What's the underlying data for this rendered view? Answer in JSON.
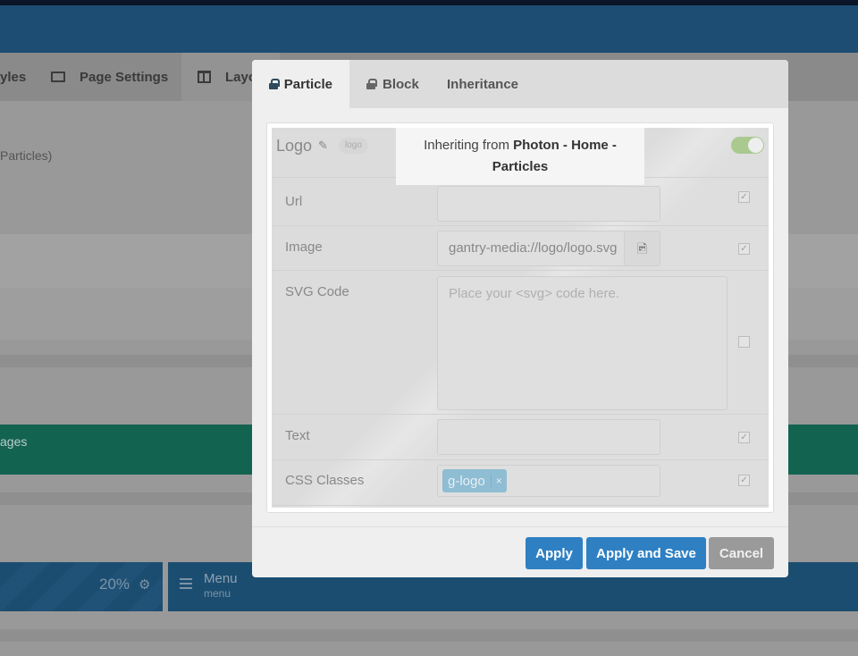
{
  "background": {
    "tabs": [
      {
        "label": "yles"
      },
      {
        "label": "Page Settings",
        "icon": "page-settings-icon"
      },
      {
        "label": "Layo",
        "icon": "layout-icon"
      }
    ],
    "section_label": "Particles)",
    "green_block_label": "ages",
    "block_percent": "20%",
    "menu": {
      "title": "Menu",
      "subtitle": "menu"
    }
  },
  "modal": {
    "tabs": [
      {
        "label": "Particle",
        "icon": "lock-icon",
        "active": true
      },
      {
        "label": "Block",
        "icon": "lock-icon"
      },
      {
        "label": "Inheritance"
      }
    ],
    "particle": {
      "title": "Logo",
      "badge": "logo",
      "enabled": true
    },
    "tooltip": {
      "prefix": "Inheriting from ",
      "source": "Photon - Home - Particles"
    },
    "fields": [
      {
        "label": "Url",
        "value": "",
        "checked": true
      },
      {
        "label": "Image",
        "value": "gantry-media://logo/logo.svg",
        "checked": true
      },
      {
        "label": "SVG Code",
        "placeholder": "Place your <svg> code here.",
        "checked": false
      },
      {
        "label": "Text",
        "value": "",
        "checked": true
      },
      {
        "label": "CSS Classes",
        "tags": [
          "g-logo"
        ],
        "checked": true
      }
    ],
    "buttons": {
      "apply": "Apply",
      "apply_save": "Apply and Save",
      "cancel": "Cancel"
    }
  },
  "colors": {
    "header": "#1e4d73",
    "primary_button": "#2f80c3",
    "cancel_button": "#9a9a9a",
    "toggle_on": "#a9c98f",
    "tag": "#8fbdd3",
    "green_block": "#136351"
  }
}
